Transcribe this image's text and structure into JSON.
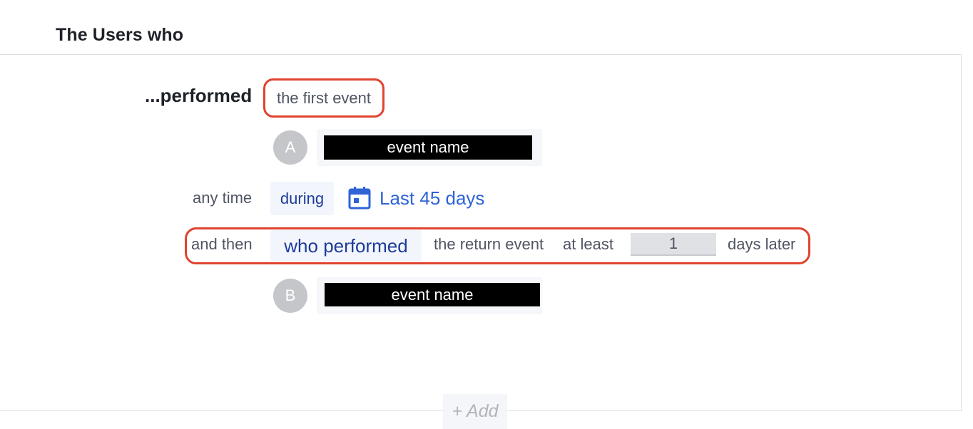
{
  "section": {
    "title": "The Users who"
  },
  "first_step": {
    "verb_label": "...performed",
    "event_type": "the first event",
    "badge": "A",
    "event_name": "event name"
  },
  "time_filter": {
    "prefix": "any time",
    "mode": "during",
    "range_icon": "calendar-icon",
    "range_label": "Last 45 days"
  },
  "return_step": {
    "connector": "and then",
    "mode": "who performed",
    "event_type": "the return event",
    "qualifier": "at least",
    "days_value": "1",
    "suffix": "days later",
    "badge": "B",
    "event_name": "event name"
  },
  "actions": {
    "add_label": "+ Add"
  },
  "colors": {
    "highlight": "#e0432e",
    "link": "#2f63d6",
    "pill_text": "#1e3a9a",
    "badge": "#c4c6ca"
  }
}
